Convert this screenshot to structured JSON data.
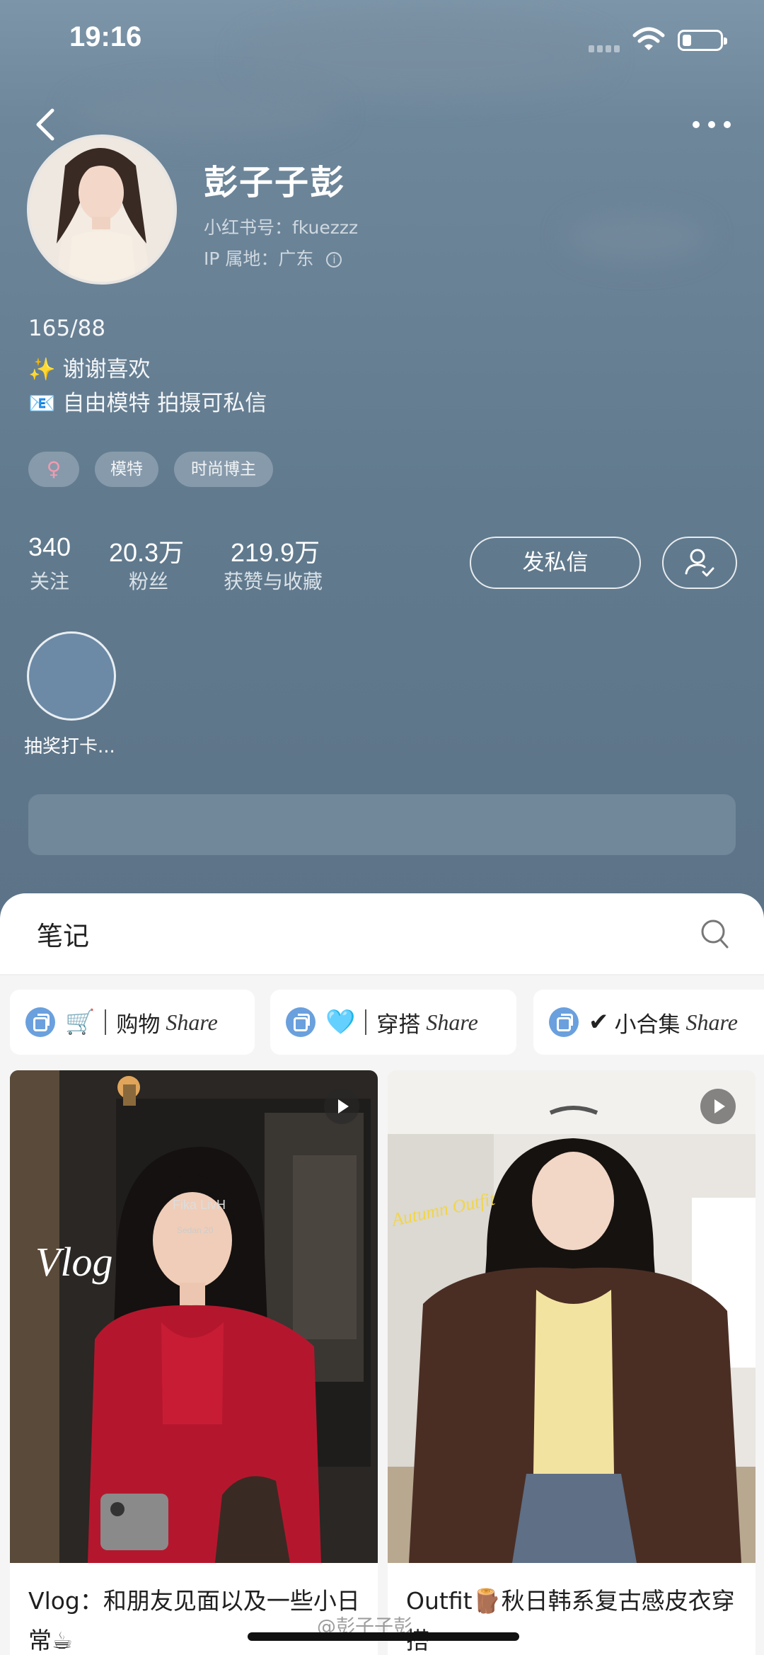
{
  "status_bar": {
    "time": "19:16"
  },
  "profile": {
    "nickname": "彭子子彭",
    "red_id": "小红书号：fkuezzz",
    "ip_location": "IP 属地：广东",
    "bio_lines": [
      "165/88",
      "✨ 谢谢喜欢",
      "📧 自由模特 拍摄可私信"
    ],
    "tags": [
      "♀",
      "模特",
      "时尚博主"
    ],
    "stats": [
      {
        "value": "340",
        "label": "关注"
      },
      {
        "value": "20.3万",
        "label": "粉丝"
      },
      {
        "value": "219.9万",
        "label": "获赞与收藏"
      }
    ],
    "message_button": "发私信",
    "highlight_label": "抽奖打卡..."
  },
  "notes": {
    "tab_title": "笔记",
    "collections": [
      {
        "emoji": "🛒",
        "label": "购物",
        "share": "Share"
      },
      {
        "emoji": "🩵",
        "label": "穿搭",
        "share": "Share"
      },
      {
        "emoji": "✔",
        "label": "小合集",
        "share": "Share"
      }
    ],
    "cards": [
      {
        "overlay_text": "Vlog",
        "sign_text": "Fika LivH",
        "sign_sub": "Sedan 20",
        "title": "Vlog：和朋友见面以及一些小日常☕"
      },
      {
        "overlay_text": "Autumn Outfit",
        "title": "Outfit🪵秋日韩系复古感皮衣穿搭"
      }
    ]
  },
  "watermark": "@彭子子彭",
  "colors": {
    "accent_blue": "#6aa0dd",
    "tag_pink": "#f29bb0",
    "sheet": "#ffffff"
  }
}
